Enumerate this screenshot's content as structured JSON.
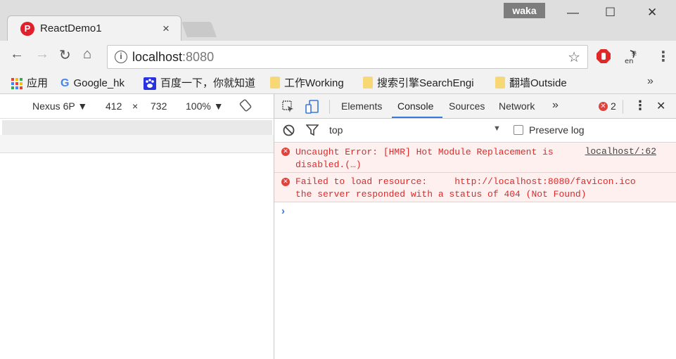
{
  "tab": {
    "title": "ReactDemo1",
    "favicon_letter": "P",
    "close": "×"
  },
  "window": {
    "profile": "waka",
    "minimize": "—",
    "maximize": "☐",
    "close": "✕"
  },
  "toolbar": {
    "back": "←",
    "forward": "→",
    "reload": "↻",
    "home": "⌂",
    "url_host": "localhost",
    "url_port": ":8080",
    "info": "i",
    "star": "☆",
    "menu": "⋮"
  },
  "bookmarks": {
    "items": [
      {
        "label": "应用",
        "icon": "apps-grid-icon"
      },
      {
        "label": "Google_hk",
        "icon": "google-g-icon"
      },
      {
        "label": "百度一下，你就知道",
        "icon": "baidu-paw-icon"
      },
      {
        "label": "工作Working",
        "icon": "folder-icon"
      },
      {
        "label": "搜索引擎SearchEngi",
        "icon": "folder-icon"
      },
      {
        "label": "翻墙Outside",
        "icon": "folder-icon"
      }
    ],
    "more": "»"
  },
  "device": {
    "name": "Nexus 6P",
    "width": "412",
    "times": "×",
    "height": "732",
    "zoom": "100%"
  },
  "devtools": {
    "tabs": [
      "Elements",
      "Console",
      "Sources",
      "Network"
    ],
    "active_tab": "Console",
    "more": "»",
    "error_count": "2",
    "close": "✕",
    "menu": "⋮"
  },
  "console": {
    "context": "top",
    "preserve_log": "Preserve log",
    "messages": [
      {
        "line1": "Uncaught Error: [HMR] Hot Module Replacement is",
        "line2": "disabled.(…)",
        "source": "localhost/:62"
      },
      {
        "line1": "Failed to load resource:     http://localhost:8080/favicon.ico",
        "line2": "the server responded with a status of 404 (Not Found)",
        "source": ""
      }
    ],
    "prompt": "›"
  },
  "colors": {
    "error_red": "#e02828",
    "error_bg": "#fff0f0",
    "accent_blue": "#3879d9"
  }
}
